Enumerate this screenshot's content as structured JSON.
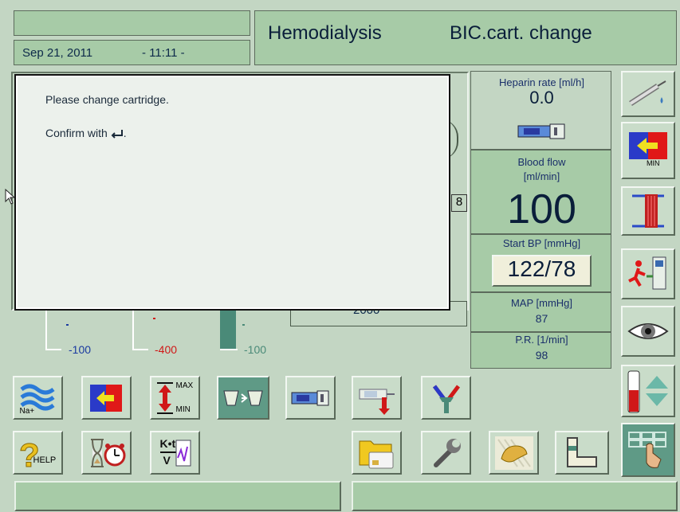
{
  "header": {
    "date": "Sep 21, 2011",
    "time": "- 11:11 -",
    "mode": "Hemodialysis",
    "status": "BIC.cart. change"
  },
  "dialog": {
    "line1": "Please change cartridge.",
    "line2": "Confirm with",
    "line2_suffix": "."
  },
  "behind_dialog": {
    "partial_value": "8",
    "lower_value": "2000"
  },
  "gauges": [
    {
      "label": "-100",
      "color": "#1a3aa0"
    },
    {
      "label": "-400",
      "color": "#d01818"
    },
    {
      "label": "-100",
      "color": "#4a8a78"
    }
  ],
  "params": {
    "heparin_label": "Heparin rate  [ml/h]",
    "heparin_value": "0.0",
    "blood_flow_label1": "Blood flow",
    "blood_flow_label2": "[ml/min]",
    "blood_flow_value": "100",
    "start_bp_label": "Start BP [mmHg]",
    "start_bp_value": "122/78",
    "map_label": "MAP   [mmHg]",
    "map_value": "87",
    "pr_label": "P.R. [1/min]",
    "pr_value": "98"
  },
  "buttons": {
    "na_sub": "Na+",
    "min_label": "MIN",
    "max_label": "MAX",
    "help_label": "HELP",
    "ktv_top": "K•t",
    "ktv_bottom": "V"
  },
  "colors": {
    "background": "#c3d6c3",
    "panel_green": "#a7cba7",
    "active_button": "#5f9a86"
  }
}
